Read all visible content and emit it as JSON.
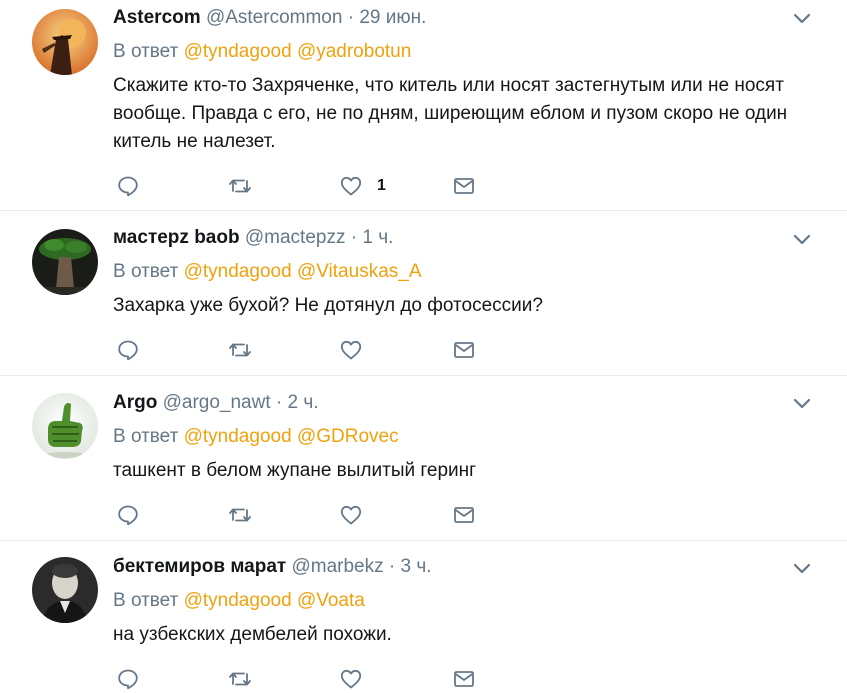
{
  "tweets": [
    {
      "name": "Astercom",
      "handle": "@Astercommon",
      "separator": "·",
      "time": "29 июн.",
      "reply_prefix": "В ответ",
      "mentions": [
        "@tyndagood",
        "@yadrobotun"
      ],
      "text": "Скажите кто-то Захряченке, что китель или носят застегнутым или не носят вообще. Правда с его, не по дням, ширеющим еблом и пузом скоро не один китель не налезет.",
      "like_count": "1"
    },
    {
      "name": "мастерz baob",
      "handle": "@mactepzz",
      "separator": "·",
      "time": "1 ч.",
      "reply_prefix": "В ответ",
      "mentions": [
        "@tyndagood",
        "@Vitauskas_A"
      ],
      "text": "Захарка уже бухой? Не дотянул до фотосессии?",
      "like_count": ""
    },
    {
      "name": "Argo",
      "handle": "@argo_nawt",
      "separator": "·",
      "time": "2 ч.",
      "reply_prefix": "В ответ",
      "mentions": [
        "@tyndagood",
        "@GDRovec"
      ],
      "text": "ташкент в белом жупане вылитый геринг",
      "like_count": ""
    },
    {
      "name": "бектемиров марат",
      "handle": "@marbekz",
      "separator": "·",
      "time": "3 ч.",
      "reply_prefix": "В ответ",
      "mentions": [
        "@tyndagood",
        "@Voata"
      ],
      "text": "на узбекских дембелей похожи.",
      "like_count": ""
    }
  ],
  "colors": {
    "accent_mention": "#f1a10d",
    "muted": "#657786",
    "text": "#14171a",
    "divider": "#e6ecf0"
  },
  "icons": [
    "chevron-down-icon",
    "reply-icon",
    "retweet-icon",
    "heart-icon",
    "message-icon"
  ]
}
